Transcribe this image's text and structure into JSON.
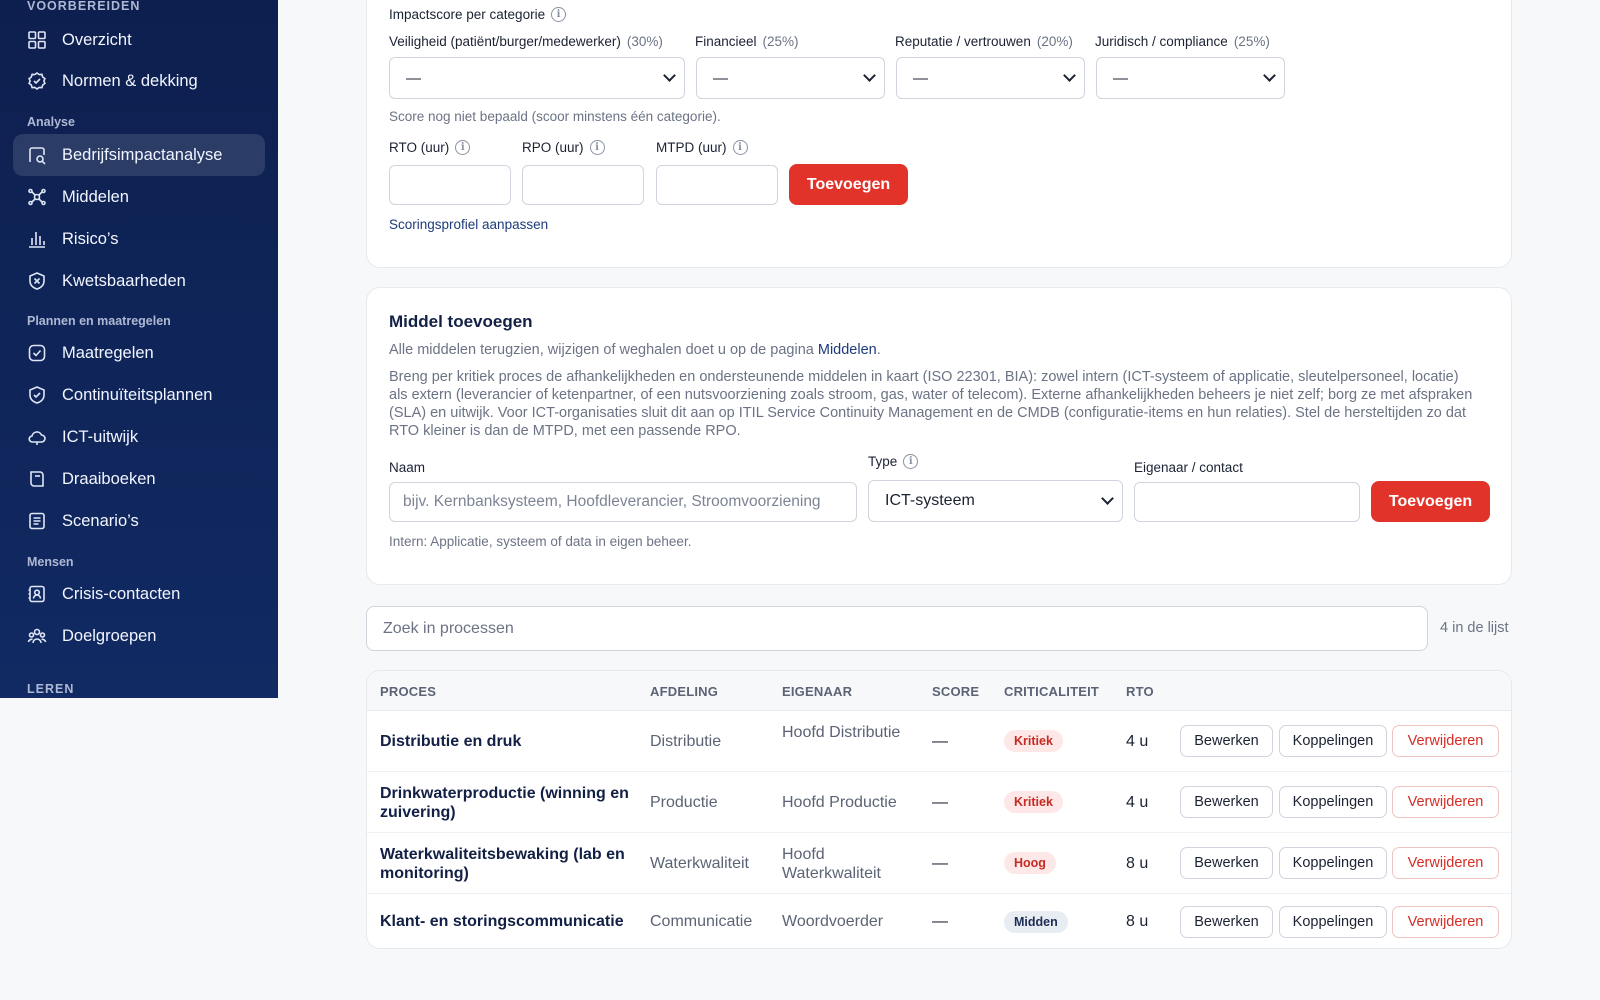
{
  "sidebar": {
    "sections": [
      {
        "label": "VOORBEREIDEN"
      },
      {
        "label": "Analyse"
      },
      {
        "label": "Plannen en maatregelen"
      },
      {
        "label": "Mensen"
      },
      {
        "label": "LEREN"
      }
    ],
    "items": [
      {
        "label": "Overzicht",
        "icon": "grid-icon"
      },
      {
        "label": "Normen & dekking",
        "icon": "badge-check-icon"
      },
      {
        "label": "Bedrijfsimpactanalyse",
        "icon": "impact-analysis-icon",
        "active": true
      },
      {
        "label": "Middelen",
        "icon": "network-icon"
      },
      {
        "label": "Risico’s",
        "icon": "bar-chart-icon"
      },
      {
        "label": "Kwetsbaarheden",
        "icon": "shield-x-icon"
      },
      {
        "label": "Maatregelen",
        "icon": "check-square-icon"
      },
      {
        "label": "Continuïteitsplannen",
        "icon": "shield-check-icon"
      },
      {
        "label": "ICT-uitwijk",
        "icon": "cloud-icon"
      },
      {
        "label": "Draaiboeken",
        "icon": "book-icon"
      },
      {
        "label": "Scenario’s",
        "icon": "list-icon"
      },
      {
        "label": "Crisis-contacten",
        "icon": "contact-card-icon"
      },
      {
        "label": "Doelgroepen",
        "icon": "users-icon"
      }
    ]
  },
  "impact": {
    "heading": "Impactscore per categorie",
    "categories": [
      {
        "name": "Veiligheid (patiënt/burger/medewerker)",
        "pct": "(30%)",
        "value": "—"
      },
      {
        "name": "Financieel",
        "pct": "(25%)",
        "value": "—"
      },
      {
        "name": "Reputatie / vertrouwen",
        "pct": "(20%)",
        "value": "—"
      },
      {
        "name": "Juridisch / compliance",
        "pct": "(25%)",
        "value": "—"
      }
    ],
    "score_note": "Score nog niet bepaald (scoor minstens één categorie).",
    "rto_label": "RTO (uur)",
    "rpo_label": "RPO (uur)",
    "mtpd_label": "MTPD (uur)",
    "add_button": "Toevoegen",
    "profile_link": "Scoringsprofiel aanpassen"
  },
  "middel": {
    "title": "Middel toevoegen",
    "intro_prefix": "Alle middelen terugzien, wijzigen of weghalen doet u op de pagina ",
    "intro_link": "Middelen",
    "intro_suffix": ".",
    "description": "Breng per kritiek proces de afhankelijkheden en ondersteunende middelen in kaart (ISO 22301, BIA): zowel intern (ICT-systeem of applicatie, sleutelpersoneel, locatie) als extern (leverancier of ketenpartner, of een nutsvoorziening zoals stroom, gas, water of telecom). Externe afhankelijkheden beheers je niet zelf; borg ze met afspraken (SLA) en uitwijk. Voor ICT-organisaties sluit dit aan op ITIL Service Continuity Management en de CMDB (configuratie-items en hun relaties). Stel de hersteltijden zo dat RTO kleiner is dan de MTPD, met een passende RPO.",
    "name_label": "Naam",
    "name_placeholder": "bijv. Kernbanksysteem, Hoofdleverancier, Stroomvoorziening",
    "type_label": "Type",
    "type_value": "ICT-systeem",
    "owner_label": "Eigenaar / contact",
    "add_button": "Toevoegen",
    "hint": "Intern: Applicatie, systeem of data in eigen beheer."
  },
  "search": {
    "placeholder": "Zoek in processen",
    "count": "4 in de lijst"
  },
  "table": {
    "headers": {
      "proces": "PROCES",
      "afdeling": "AFDELING",
      "eigenaar": "EIGENAAR",
      "score": "SCORE",
      "criticaliteit": "CRITICALITEIT",
      "rto": "RTO"
    },
    "actions": {
      "edit": "Bewerken",
      "links": "Koppelingen",
      "delete": "Verwijderen"
    },
    "rows": [
      {
        "proces": "Distributie en druk",
        "afdeling": "Distributie",
        "eigenaar": "Hoofd Distributie",
        "score": "—",
        "criticaliteit": "Kritiek",
        "rto": "4 u"
      },
      {
        "proces": "Drinkwaterproductie (winning en zuivering)",
        "afdeling": "Productie",
        "eigenaar": "Hoofd Productie",
        "score": "—",
        "criticaliteit": "Kritiek",
        "rto": "4 u"
      },
      {
        "proces": "Waterkwaliteitsbewaking (lab en monitoring)",
        "afdeling": "Waterkwaliteit",
        "eigenaar": "Hoofd Waterkwaliteit",
        "score": "—",
        "criticaliteit": "Hoog",
        "rto": "8 u"
      },
      {
        "proces": "Klant- en storingscommunicatie",
        "afdeling": "Communicatie",
        "eigenaar": "Woordvoerder",
        "score": "—",
        "criticaliteit": "Midden",
        "rto": "8 u"
      }
    ]
  }
}
